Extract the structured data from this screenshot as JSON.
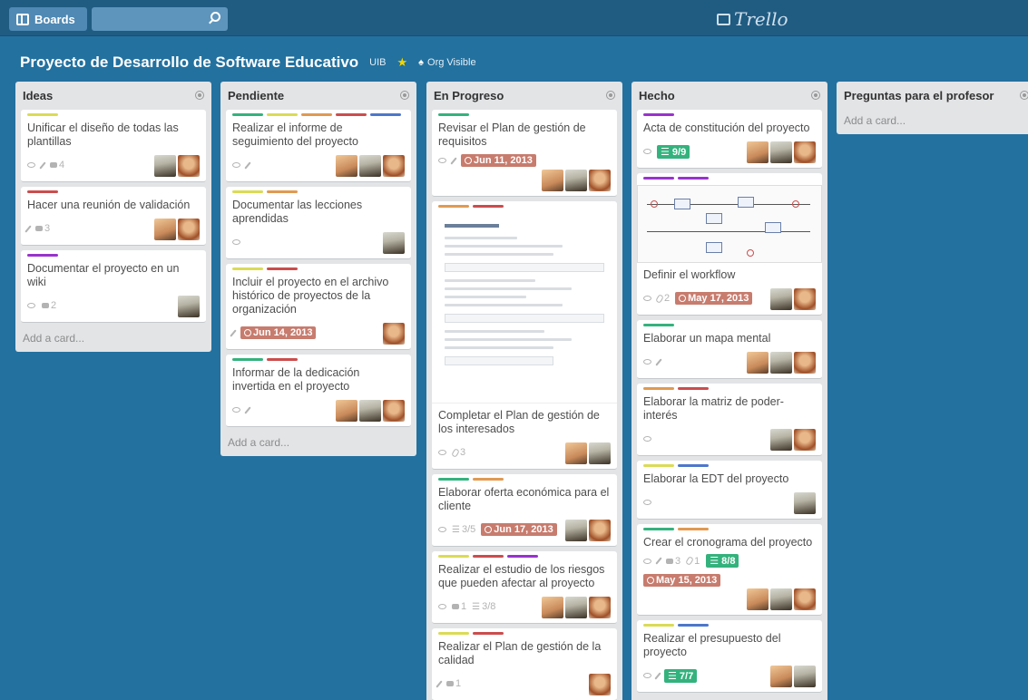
{
  "header": {
    "boards_label": "Boards",
    "logo_text": "Trello"
  },
  "board": {
    "title": "Proyecto de Desarrollo de Software Educativo",
    "org": "UIB",
    "visibility": "Org Visible"
  },
  "add_card_label": "Add a card...",
  "lists": [
    {
      "title": "Ideas",
      "cards": [
        {
          "title": "Unificar el diseño de todas las plantillas",
          "comments": "4"
        },
        {
          "title": "Hacer una reunión de validación",
          "comments": "3"
        },
        {
          "title": "Documentar el proyecto en un wiki",
          "comments": "2"
        }
      ]
    },
    {
      "title": "Pendiente",
      "cards": [
        {
          "title": "Realizar el informe de seguimiento del proyecto"
        },
        {
          "title": "Documentar las lecciones aprendidas"
        },
        {
          "title": "Incluir el proyecto en el archivo histórico de proyectos de la organización",
          "due": "Jun 14, 2013"
        },
        {
          "title": "Informar de la dedicación invertida en el proyecto"
        }
      ]
    },
    {
      "title": "En Progreso",
      "cards": [
        {
          "title": "Revisar el Plan de gestión de requisitos",
          "due": "Jun 11, 2013"
        },
        {
          "title": "Completar el Plan de gestión de los interesados",
          "attachments": "3"
        },
        {
          "title": "Elaborar oferta económica para el cliente",
          "checklist": "3/5",
          "due": "Jun 17, 2013"
        },
        {
          "title": "Realizar el estudio de los riesgos que pueden afectar al proyecto",
          "comments": "1",
          "checklist": "3/8"
        },
        {
          "title": "Realizar el Plan de gestión de la calidad",
          "comments": "1"
        }
      ]
    },
    {
      "title": "Hecho",
      "cards": [
        {
          "title": "Acta de constitución del proyecto",
          "checklist": "9/9"
        },
        {
          "title": "Definir el workflow",
          "attachments": "2",
          "due": "May 17, 2013"
        },
        {
          "title": "Elaborar un mapa mental"
        },
        {
          "title": "Elaborar la matriz de poder-interés"
        },
        {
          "title": "Elaborar la EDT del proyecto"
        },
        {
          "title": "Crear el cronograma del proyecto",
          "comments": "3",
          "attachments": "1",
          "checklist": "8/8",
          "due": "May 15, 2013"
        },
        {
          "title": "Realizar el presupuesto del proyecto",
          "checklist": "7/7"
        }
      ]
    },
    {
      "title": "Preguntas para el profesor",
      "cards": []
    }
  ],
  "colors": {
    "board_bg": "#23719f",
    "header_bg": "#205b82",
    "list_bg": "#e2e4e6",
    "due_bg": "#b04632",
    "done_bg": "#34b27d"
  }
}
